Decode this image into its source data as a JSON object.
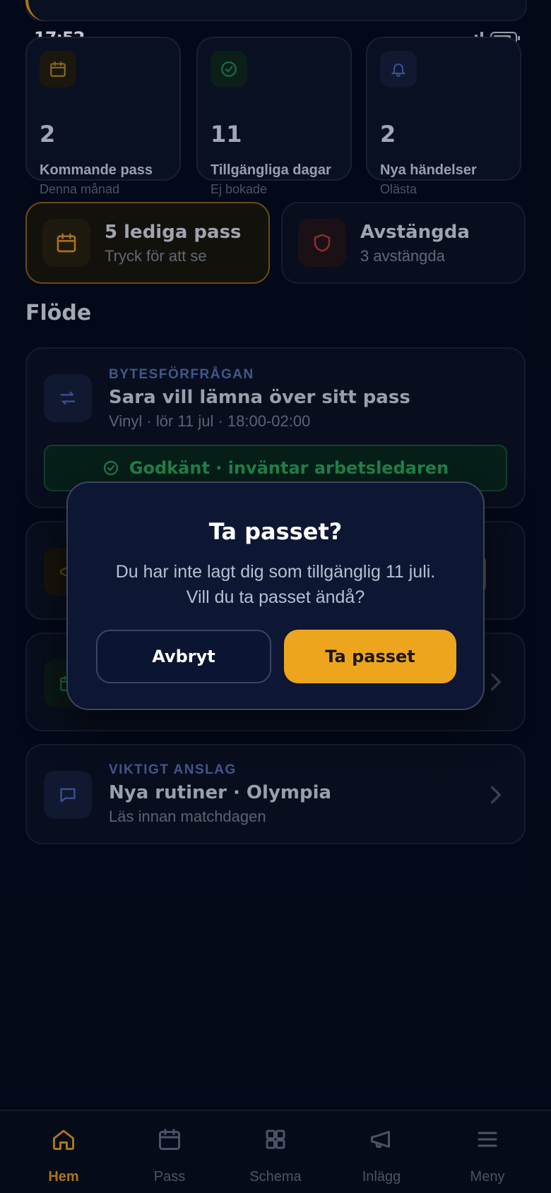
{
  "status": {
    "time": "17:52"
  },
  "stats": [
    {
      "icon": "calendar-icon",
      "value": "2",
      "label": "Kommande pass",
      "sub": "Denna månad"
    },
    {
      "icon": "check-circle-icon",
      "value": "11",
      "label": "Tillgängliga dagar",
      "sub": "Ej bokade"
    },
    {
      "icon": "bell-icon",
      "value": "2",
      "label": "Nya händelser",
      "sub": "Olästa"
    }
  ],
  "quick": [
    {
      "icon": "calendar-icon",
      "title": "5 lediga pass",
      "sub": "Tryck för att se"
    },
    {
      "icon": "shield-icon",
      "title": "Avstängda",
      "sub": "3 avstängda"
    }
  ],
  "feed_title": "Flöde",
  "feed": [
    {
      "icon": "swap-icon",
      "category": "BYTESFÖRFRÅGAN",
      "title": "Sara vill lämna över sitt pass",
      "sub": "Vinyl · lör 11 jul · 18:00-02:00",
      "status": "Godkänt · inväntar arbetsledaren"
    },
    {
      "icon": "message-icon",
      "category": "VIKTIGT ANSLAG",
      "title": "Nya rutiner · Olympia",
      "sub": "Läs innan matchdagen"
    }
  ],
  "modal": {
    "title": "Ta passet?",
    "line1": "Du har inte lagt dig som tillgänglig 11 juli.",
    "line2": "Vill du ta passet ändå?",
    "cancel": "Avbryt",
    "confirm": "Ta passet"
  },
  "tabs": [
    {
      "icon": "home-icon",
      "label": "Hem",
      "active": true
    },
    {
      "icon": "calendar-icon",
      "label": "Pass"
    },
    {
      "icon": "grid-icon",
      "label": "Schema"
    },
    {
      "icon": "megaphone-icon",
      "label": "Inlägg"
    },
    {
      "icon": "menu-icon",
      "label": "Meny"
    }
  ],
  "colors": {
    "accent": "#eda51e",
    "background": "#050a1a",
    "success": "#23874d",
    "danger": "#c0392b"
  }
}
